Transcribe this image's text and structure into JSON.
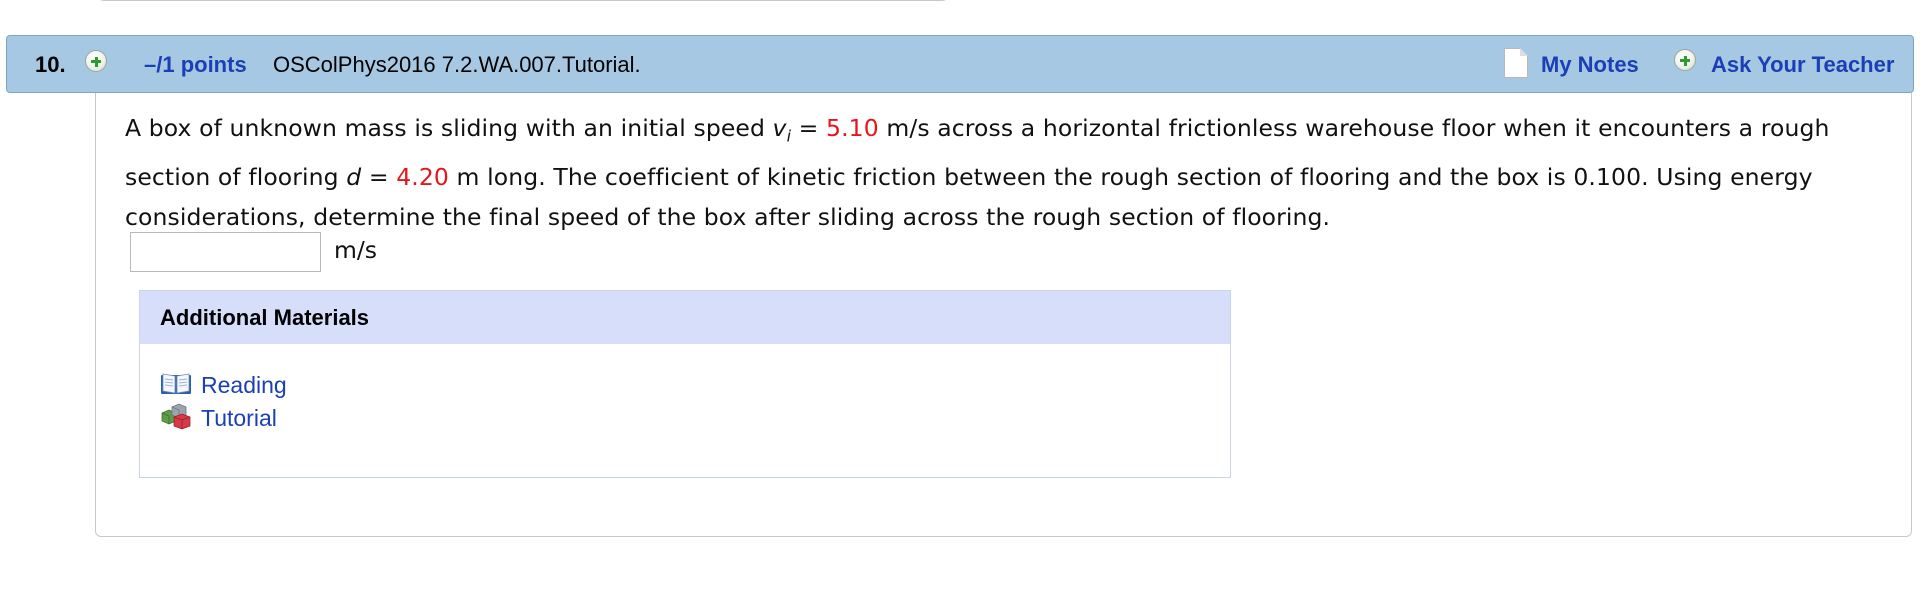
{
  "question": {
    "number": "10.",
    "points_label": "–/1 points",
    "reference": "OSColPhys2016 7.2.WA.007.Tutorial.",
    "my_notes_label": "My Notes",
    "ask_teacher_label": "Ask Your Teacher",
    "icons": {
      "points_toggle": "plus-circle-icon",
      "notes": "note-page-icon",
      "ask_teacher": "plus-circle-icon"
    }
  },
  "problem": {
    "part1": "A box of unknown mass is sliding with an initial speed ",
    "vi_symbol": "v",
    "vi_subscript": "i",
    "equals1": " = ",
    "vi_value": "5.10",
    "part2": " m/s across a horizontal frictionless warehouse floor when it encounters a rough section of flooring ",
    "d_symbol": "d",
    "equals2": " = ",
    "d_value": "4.20",
    "part3": " m long. The coefficient of kinetic friction between the rough section of flooring and the box is 0.100. Using energy considerations, determine the final speed of the box after sliding across the rough section of flooring."
  },
  "answer": {
    "value": "",
    "unit": "m/s"
  },
  "additional_materials": {
    "title": "Additional Materials",
    "items": [
      {
        "label": "Reading",
        "icon": "book-icon"
      },
      {
        "label": "Tutorial",
        "icon": "cubes-icon"
      }
    ]
  },
  "colors": {
    "header_bg": "#a6c8e3",
    "link": "#1b3fb5",
    "given_value": "#e8141a",
    "materials_header_bg": "#d6defa"
  }
}
